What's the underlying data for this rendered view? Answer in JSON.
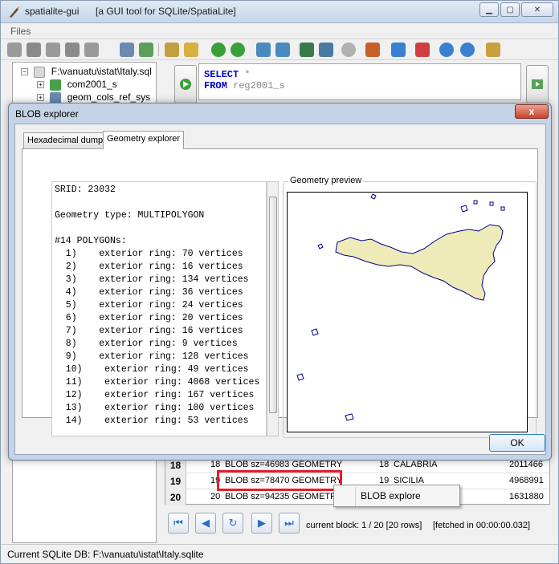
{
  "window": {
    "title": "spatialite-gui",
    "subtitle": "[a GUI tool for SQLite/SpatiaLite]"
  },
  "menu": {
    "files": "Files"
  },
  "tree": {
    "root": "F:\\vanuatu\\istat\\Italy.sql",
    "items": [
      "com2001_s",
      "geom_cols_ref_sys"
    ]
  },
  "sql": {
    "line1_kw": "SELECT",
    "line1_rest": " *",
    "line2_kw": "FROM",
    "line2_rest": " reg2001_s"
  },
  "grid": {
    "rows": [
      {
        "num": "18",
        "id": "18",
        "blob": "BLOB sz=46983 GEOMETRY",
        "code": "18",
        "name": "CALABRIA",
        "value": "2011466"
      },
      {
        "num": "19",
        "id": "19",
        "blob": "BLOB sz=78470 GEOMETRY",
        "code": "19",
        "name": "SICILIA",
        "value": "4968991"
      },
      {
        "num": "20",
        "id": "20",
        "blob": "BLOB sz=94235 GEOMETRY",
        "code": "",
        "name": "",
        "value": "1631880"
      }
    ]
  },
  "context_menu": {
    "item": "BLOB explore"
  },
  "navigation": {
    "block_info": "current block: 1 / 20 [20 rows]",
    "fetch_info": "[fetched in 00:00:00.032]"
  },
  "status": {
    "text": "Current SQLite DB: F:\\vanuatu\\istat\\Italy.sqlite"
  },
  "dialog": {
    "title": "BLOB explorer",
    "close": "x",
    "tabs": [
      "Hexadecimal dump",
      "Geometry explorer"
    ],
    "ok": "OK",
    "preview_label": "Geometry preview",
    "geometry_lines": [
      "SRID: 23032",
      "",
      "Geometry type: MULTIPOLYGON",
      "",
      "#14 POLYGONs:",
      "  1)    exterior ring: 70 vertices",
      "  2)    exterior ring: 16 vertices",
      "  3)    exterior ring: 134 vertices",
      "  4)    exterior ring: 36 vertices",
      "  5)    exterior ring: 24 vertices",
      "  6)    exterior ring: 20 vertices",
      "  7)    exterior ring: 16 vertices",
      "  8)    exterior ring: 9 vertices",
      "  9)    exterior ring: 128 vertices",
      "  10)    exterior ring: 49 vertices",
      "  11)    exterior ring: 4068 vertices",
      "  12)    exterior ring: 167 vertices",
      "  13)    exterior ring: 100 vertices",
      "  14)    exterior ring: 53 vertices"
    ]
  },
  "colors": {
    "accent_red": "#e0202a",
    "polygon_fill": "#eeebb9",
    "polygon_stroke": "#00008b",
    "sql_keyword": "#0000c8"
  }
}
